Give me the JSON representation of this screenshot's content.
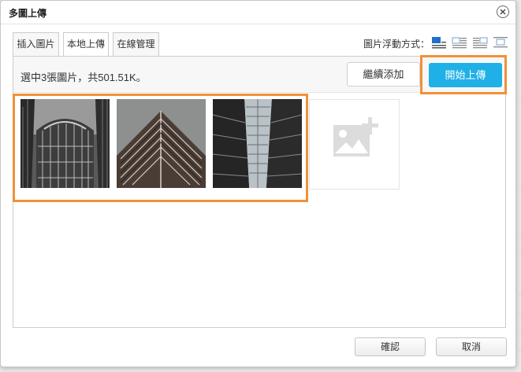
{
  "dialog": {
    "title": "多圖上傳"
  },
  "tabs": [
    {
      "label": "插入圖片",
      "active": false
    },
    {
      "label": "本地上傳",
      "active": true
    },
    {
      "label": "在線管理",
      "active": false
    }
  ],
  "float_options": {
    "label": "圖片浮動方式：",
    "options": [
      {
        "icon": "align-none-icon",
        "selected": true
      },
      {
        "icon": "align-left-icon",
        "selected": false
      },
      {
        "icon": "align-right-icon",
        "selected": false
      },
      {
        "icon": "align-center-icon",
        "selected": false
      }
    ]
  },
  "upload": {
    "summary": "選中3張圖片，共501.51K。",
    "continue_label": "繼續添加",
    "start_label": "開始上傳"
  },
  "thumbnails": [
    {
      "icon": "building-photo-1"
    },
    {
      "icon": "building-photo-2"
    },
    {
      "icon": "building-photo-3"
    }
  ],
  "add_placeholder": {
    "icon": "add-image-icon"
  },
  "footer": {
    "ok_label": "確認",
    "cancel_label": "取消"
  },
  "colors": {
    "accent": "#1fb0e8",
    "highlight": "#f0913a",
    "selected_icon": "#1f6fc9"
  }
}
